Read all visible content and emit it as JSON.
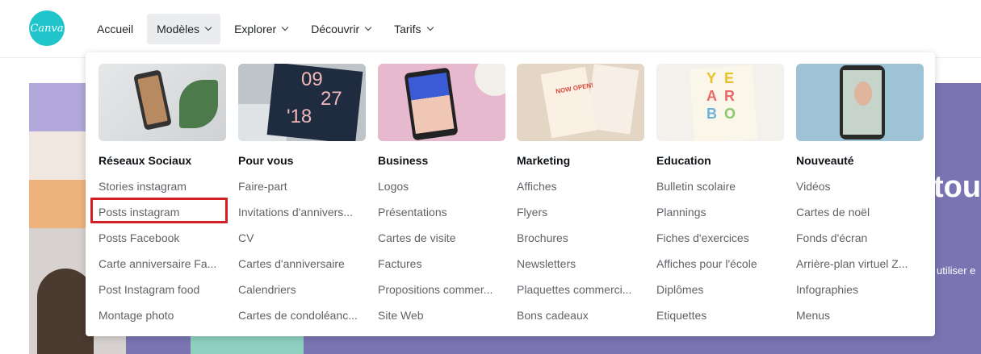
{
  "logo": {
    "text": "Canva"
  },
  "nav": {
    "items": [
      {
        "label": "Accueil",
        "dropdown": false,
        "active": false
      },
      {
        "label": "Modèles",
        "dropdown": true,
        "active": true
      },
      {
        "label": "Explorer",
        "dropdown": true,
        "active": false
      },
      {
        "label": "Découvrir",
        "dropdown": true,
        "active": false
      },
      {
        "label": "Tarifs",
        "dropdown": true,
        "active": false
      }
    ]
  },
  "hero": {
    "headline_fragment": "tou",
    "subline_fragment": "utiliser e"
  },
  "menu": {
    "columns": [
      {
        "title": "Réseaux Sociaux",
        "links": [
          "Stories instagram",
          "Posts instagram",
          "Posts Facebook",
          "Carte anniversaire Fa...",
          "Post Instagram food",
          "Montage photo"
        ]
      },
      {
        "title": "Pour vous",
        "links": [
          "Faire-part",
          "Invitations d'annivers...",
          "CV",
          "Cartes d'anniversaire",
          "Calendriers",
          "Cartes de condoléanc..."
        ]
      },
      {
        "title": "Business",
        "links": [
          "Logos",
          "Présentations",
          "Cartes de visite",
          "Factures",
          "Propositions commer...",
          "Site Web"
        ]
      },
      {
        "title": "Marketing",
        "links": [
          "Affiches",
          "Flyers",
          "Brochures",
          "Newsletters",
          "Plaquettes commerci...",
          "Bons cadeaux"
        ]
      },
      {
        "title": "Education",
        "links": [
          "Bulletin scolaire",
          "Plannings",
          "Fiches d'exercices",
          "Affiches pour l'école",
          "Diplômes",
          "Etiquettes"
        ]
      },
      {
        "title": "Nouveauté",
        "links": [
          "Vidéos",
          "Cartes de noël",
          "Fonds d'écran",
          "Arrière-plan virtuel Z...",
          "Infographies",
          "Menus"
        ]
      }
    ],
    "highlighted_link": "Posts instagram"
  },
  "thumb_text": {
    "date": [
      "09",
      "27",
      "'18"
    ],
    "marketing_card": "NOW OPEN!",
    "yearbook": [
      "Y",
      "E",
      "A",
      "R",
      "B",
      "O"
    ]
  },
  "colors": {
    "brand": "#20c4cb",
    "highlight": "#d21e25",
    "hero": "#7a74b2"
  }
}
